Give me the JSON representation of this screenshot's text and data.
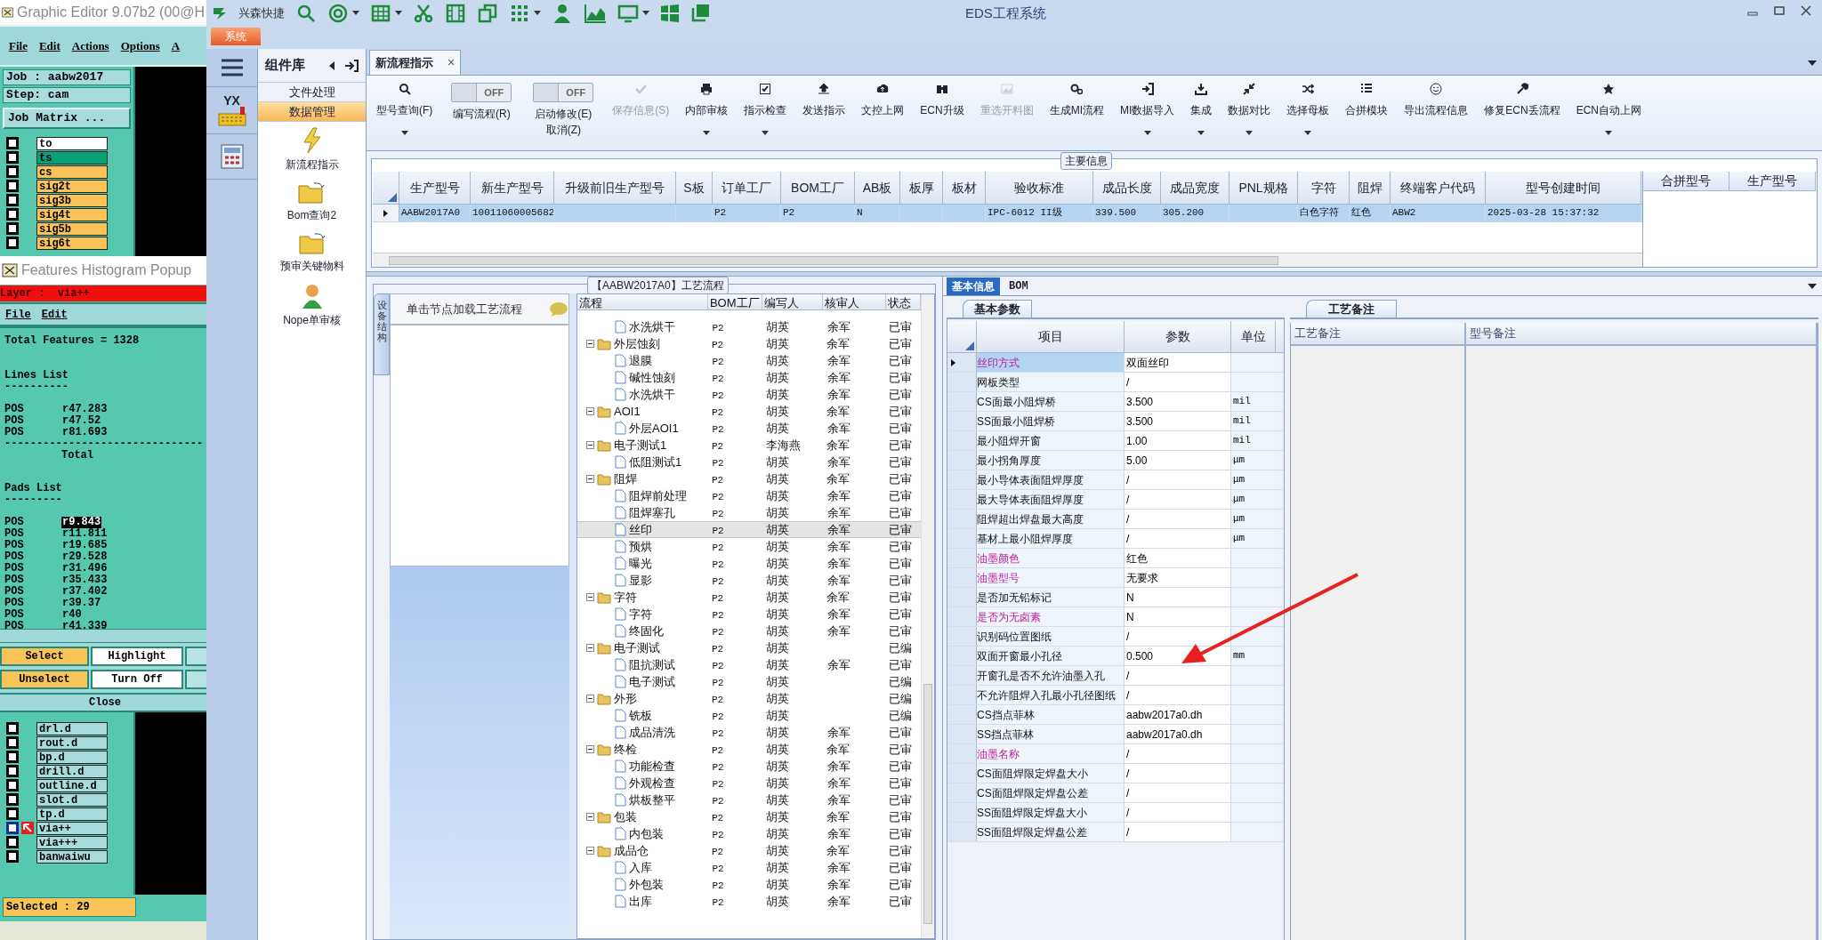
{
  "graphic_editor": {
    "title": "Graphic Editor 9.07b2 (00@H",
    "menu": [
      "File",
      "Edit",
      "Actions",
      "Options",
      "A"
    ],
    "job": "Job : aabw2017",
    "step": "Step: cam",
    "job_matrix_button": "Job Matrix ...",
    "layers_top": [
      {
        "name": "to",
        "color": "#ffffff",
        "checked": false
      },
      {
        "name": "ts",
        "color": "#0aa078",
        "checked": false
      },
      {
        "name": "cs",
        "color": "#f8c458",
        "checked": false
      },
      {
        "name": "sig2t",
        "color": "#f8c458",
        "checked": false
      },
      {
        "name": "sig3b",
        "color": "#f8c458",
        "checked": false
      },
      {
        "name": "sig4t",
        "color": "#f8c458",
        "checked": false
      },
      {
        "name": "sig5b",
        "color": "#f8c458",
        "checked": false
      },
      {
        "name": "sig6t",
        "color": "#f8c458",
        "checked": false
      }
    ],
    "layers_bottom": [
      {
        "name": "drl.d",
        "checked": false,
        "selected": false
      },
      {
        "name": "rout.d",
        "checked": false,
        "selected": false
      },
      {
        "name": "bp.d",
        "checked": false,
        "selected": false
      },
      {
        "name": "drill.d",
        "checked": false,
        "selected": false
      },
      {
        "name": "outline.d",
        "checked": false,
        "selected": false
      },
      {
        "name": "slot.d",
        "checked": false,
        "selected": false
      },
      {
        "name": "tp.d",
        "checked": false,
        "selected": false
      },
      {
        "name": "via++",
        "checked": false,
        "selected": true
      },
      {
        "name": "via+++",
        "checked": false,
        "selected": false
      },
      {
        "name": "banwaiwu",
        "checked": false,
        "selected": false
      }
    ],
    "selected_count": "Selected : 29"
  },
  "histogram_popup": {
    "title": "Features Histogram Popup",
    "layer": "Layer :  via++",
    "menu": [
      "File",
      "Edit"
    ],
    "total": "Total Features = 1328",
    "lines_heading": "Lines List",
    "lines_rule": "----------",
    "lines": [
      {
        "type": "POS",
        "size": "r47.283"
      },
      {
        "type": "POS",
        "size": "r47.52"
      },
      {
        "type": "POS",
        "size": "r81.693"
      }
    ],
    "total_rule": "-------------------------------",
    "lines_total": "Total",
    "pads_heading": "Pads List",
    "pads_rule": "---------",
    "pads": [
      {
        "type": "POS",
        "size": "r9.843",
        "selected": true
      },
      {
        "type": "POS",
        "size": "r11.811",
        "selected": false
      },
      {
        "type": "POS",
        "size": "r19.685",
        "selected": false
      },
      {
        "type": "POS",
        "size": "r29.528",
        "selected": false
      },
      {
        "type": "POS",
        "size": "r31.496",
        "selected": false
      },
      {
        "type": "POS",
        "size": "r35.433",
        "selected": false
      },
      {
        "type": "POS",
        "size": "r37.402",
        "selected": false
      },
      {
        "type": "POS",
        "size": "r39.37",
        "selected": false
      },
      {
        "type": "POS",
        "size": "r40",
        "selected": false
      },
      {
        "type": "POS",
        "size": "r41.339",
        "selected": false
      }
    ],
    "buttons": [
      {
        "label": "Select",
        "kind": "action"
      },
      {
        "label": "Highlight",
        "kind": "plain"
      },
      {
        "label": "Unselect",
        "kind": "action"
      },
      {
        "label": "Turn Off",
        "kind": "plain"
      }
    ],
    "close": "Close"
  },
  "eds": {
    "quick_access_label": "兴森快捷",
    "title": "EDS工程系统",
    "system_tab": "系统",
    "rail_logo": "YX",
    "component_library": {
      "title": "组件库",
      "categories": [
        {
          "label": "文件处理",
          "selected": false
        },
        {
          "label": "数据管理",
          "selected": true
        }
      ],
      "items": [
        {
          "label": "新流程指示",
          "kind": "bolt"
        },
        {
          "label": "Bom查询2",
          "kind": "folder"
        },
        {
          "label": "预审关键物料",
          "kind": "folder"
        },
        {
          "label": "Nope单审核",
          "kind": "person"
        }
      ]
    },
    "document_tab": {
      "label": "新流程指示",
      "close": "×"
    },
    "ribbon": [
      {
        "kind": "button",
        "label": "型号查询(F)",
        "dropdown": true,
        "disabled": false
      },
      {
        "kind": "toggle",
        "label": "编写流程(R)",
        "state": "OFF",
        "on": false
      },
      {
        "kind": "toggle",
        "label": "启动修改(E) 取消(Z)",
        "state": "OFF",
        "on": false
      },
      {
        "kind": "button",
        "label": "保存信息(S)",
        "dropdown": false,
        "disabled": true
      },
      {
        "kind": "button",
        "label": "内部审核",
        "dropdown": true,
        "disabled": false
      },
      {
        "kind": "button",
        "label": "指示检查",
        "dropdown": true,
        "disabled": false
      },
      {
        "kind": "button",
        "label": "发送指示",
        "dropdown": false,
        "disabled": false
      },
      {
        "kind": "button",
        "label": "文控上网",
        "dropdown": false,
        "disabled": false
      },
      {
        "kind": "button",
        "label": "ECN升级",
        "dropdown": false,
        "disabled": false
      },
      {
        "kind": "button",
        "label": "重选开料图",
        "dropdown": false,
        "disabled": true
      },
      {
        "kind": "button",
        "label": "生成MI流程",
        "dropdown": false,
        "disabled": false
      },
      {
        "kind": "button",
        "label": "MI数据导入",
        "dropdown": true,
        "disabled": false
      },
      {
        "kind": "button",
        "label": "集成",
        "dropdown": true,
        "disabled": false
      },
      {
        "kind": "button",
        "label": "数据对比",
        "dropdown": true,
        "disabled": false
      },
      {
        "kind": "button",
        "label": "选择母板",
        "dropdown": true,
        "disabled": false
      },
      {
        "kind": "button",
        "label": "合拼模块",
        "dropdown": false,
        "disabled": false
      },
      {
        "kind": "button",
        "label": "导出流程信息",
        "dropdown": false,
        "disabled": false
      },
      {
        "kind": "button",
        "label": "修复ECN丢流程",
        "dropdown": false,
        "disabled": false
      },
      {
        "kind": "button",
        "label": "ECN自动上网",
        "dropdown": true,
        "disabled": false
      }
    ],
    "main_info": {
      "title": "主要信息",
      "columns": [
        "生产型号",
        "新生产型号",
        "升级前旧生产型号",
        "S板",
        "订单工厂",
        "BOM工厂",
        "AB板",
        "板厚",
        "板材",
        "验收标准",
        "成品长度",
        "成品宽度",
        "PNL规格",
        "字符",
        "阻焊",
        "终端客户代码",
        "型号创建时间"
      ],
      "rows": [
        {
          "selected": true,
          "cells": [
            "AABW2017A0",
            "10011060005682",
            null,
            null,
            "P2",
            "P2",
            "N",
            null,
            null,
            "IPC-6012 II级",
            "339.500",
            "305.200",
            null,
            "白色字符",
            "红色",
            "ABW2",
            "2025-03-28 15:37:32"
          ]
        }
      ],
      "merge_columns": [
        "合拼型号",
        "生产型号"
      ]
    },
    "process_flow": {
      "title": "【AABW2017A0】工艺流程",
      "side_tab": "设备结构",
      "hint": "单击节点加载工艺流程",
      "columns": [
        "流程",
        "BOM工厂",
        "编写人",
        "核审人",
        "状态"
      ],
      "tree": [
        {
          "kind": "file",
          "label": "水洗烘干",
          "bom": "P2",
          "writer": "胡英",
          "reviewer": "余军",
          "status": "已审",
          "selected": false
        },
        {
          "kind": "folder",
          "label": "外层蚀刻",
          "bom": "P2",
          "writer": "胡英",
          "reviewer": "余军",
          "status": "已审",
          "selected": false,
          "children": [
            {
              "kind": "file",
              "label": "退膜",
              "bom": "P2",
              "writer": "胡英",
              "reviewer": "余军",
              "status": "已审",
              "selected": false
            },
            {
              "kind": "file",
              "label": "碱性蚀刻",
              "bom": "P2",
              "writer": "胡英",
              "reviewer": "余军",
              "status": "已审",
              "selected": false
            },
            {
              "kind": "file",
              "label": "水洗烘干",
              "bom": "P2",
              "writer": "胡英",
              "reviewer": "余军",
              "status": "已审",
              "selected": false
            }
          ]
        },
        {
          "kind": "folder",
          "label": "AOI1",
          "bom": "P2",
          "writer": "胡英",
          "reviewer": "余军",
          "status": "已审",
          "selected": false,
          "children": [
            {
              "kind": "file",
              "label": "外层AOI1",
              "bom": "P2",
              "writer": "胡英",
              "reviewer": "余军",
              "status": "已审",
              "selected": false
            }
          ]
        },
        {
          "kind": "folder",
          "label": "电子测试1",
          "bom": "P2",
          "writer": "李海燕",
          "reviewer": "余军",
          "status": "已审",
          "selected": false,
          "children": [
            {
              "kind": "file",
              "label": "低阻测试1",
              "bom": "P2",
              "writer": "胡英",
              "reviewer": "余军",
              "status": "已审",
              "selected": false
            }
          ]
        },
        {
          "kind": "folder",
          "label": "阻焊",
          "bom": "P2",
          "writer": "胡英",
          "reviewer": "余军",
          "status": "已审",
          "selected": false,
          "children": [
            {
              "kind": "file",
              "label": "阻焊前处理",
              "bom": "P2",
              "writer": "胡英",
              "reviewer": "余军",
              "status": "已审",
              "selected": false
            },
            {
              "kind": "file",
              "label": "阻焊塞孔",
              "bom": "P2",
              "writer": "胡英",
              "reviewer": "余军",
              "status": "已审",
              "selected": false
            },
            {
              "kind": "file",
              "label": "丝印",
              "bom": "P2",
              "writer": "胡英",
              "reviewer": "余军",
              "status": "已审",
              "selected": true
            },
            {
              "kind": "file",
              "label": "预烘",
              "bom": "P2",
              "writer": "胡英",
              "reviewer": "余军",
              "status": "已审",
              "selected": false
            },
            {
              "kind": "file",
              "label": "曝光",
              "bom": "P2",
              "writer": "胡英",
              "reviewer": "余军",
              "status": "已审",
              "selected": false
            },
            {
              "kind": "file",
              "label": "显影",
              "bom": "P2",
              "writer": "胡英",
              "reviewer": "余军",
              "status": "已审",
              "selected": false
            }
          ]
        },
        {
          "kind": "folder",
          "label": "字符",
          "bom": "P2",
          "writer": "胡英",
          "reviewer": "余军",
          "status": "已审",
          "selected": false,
          "children": [
            {
              "kind": "file",
              "label": "字符",
              "bom": "P2",
              "writer": "胡英",
              "reviewer": "余军",
              "status": "已审",
              "selected": false
            },
            {
              "kind": "file",
              "label": "终固化",
              "bom": "P2",
              "writer": "胡英",
              "reviewer": "余军",
              "status": "已审",
              "selected": false
            }
          ]
        },
        {
          "kind": "folder",
          "label": "电子测试",
          "bom": "P2",
          "writer": "胡英",
          "status": "已编",
          "selected": false,
          "children": [
            {
              "kind": "file",
              "label": "阻抗测试",
              "bom": "P2",
              "writer": "胡英",
              "reviewer": "余军",
              "status": "已审",
              "selected": false
            },
            {
              "kind": "file",
              "label": "电子测试",
              "bom": "P2",
              "writer": "胡英",
              "status": "已编",
              "selected": false
            }
          ]
        },
        {
          "kind": "folder",
          "label": "外形",
          "bom": "P2",
          "writer": "胡英",
          "status": "已编",
          "selected": false,
          "children": [
            {
              "kind": "file",
              "label": "铣板",
              "bom": "P2",
              "writer": "胡英",
              "status": "已编",
              "selected": false
            },
            {
              "kind": "file",
              "label": "成品清洗",
              "bom": "P2",
              "writer": "胡英",
              "reviewer": "余军",
              "status": "已审",
              "selected": false
            }
          ]
        },
        {
          "kind": "folder",
          "label": "终检",
          "bom": "P2",
          "writer": "胡英",
          "reviewer": "余军",
          "status": "已审",
          "selected": false,
          "children": [
            {
              "kind": "file",
              "label": "功能检查",
              "bom": "P2",
              "writer": "胡英",
              "reviewer": "余军",
              "status": "已审",
              "selected": false
            },
            {
              "kind": "file",
              "label": "外观检查",
              "bom": "P2",
              "writer": "胡英",
              "reviewer": "余军",
              "status": "已审",
              "selected": false
            },
            {
              "kind": "file",
              "label": "烘板整平",
              "bom": "P2",
              "writer": "胡英",
              "reviewer": "余军",
              "status": "已审",
              "selected": false
            }
          ]
        },
        {
          "kind": "folder",
          "label": "包装",
          "bom": "P2",
          "writer": "胡英",
          "reviewer": "余军",
          "status": "已审",
          "selected": false,
          "children": [
            {
              "kind": "file",
              "label": "内包装",
              "bom": "P2",
              "writer": "胡英",
              "reviewer": "余军",
              "status": "已审",
              "selected": false
            }
          ]
        },
        {
          "kind": "folder",
          "label": "成品仓",
          "bom": "P2",
          "writer": "胡英",
          "reviewer": "余军",
          "status": "已审",
          "selected": false,
          "children": [
            {
              "kind": "file",
              "label": "入库",
              "bom": "P2",
              "writer": "胡英",
              "reviewer": "余军",
              "status": "已审",
              "selected": false
            },
            {
              "kind": "file",
              "label": "外包装",
              "bom": "P2",
              "writer": "胡英",
              "reviewer": "余军",
              "status": "已审",
              "selected": false
            },
            {
              "kind": "file",
              "label": "出库",
              "bom": "P2",
              "writer": "胡英",
              "reviewer": "余军",
              "status": "已审",
              "selected": false
            }
          ]
        }
      ]
    },
    "detail": {
      "tabs": [
        {
          "label": "基本信息",
          "selected": true
        },
        {
          "label": "BOM",
          "selected": false
        }
      ],
      "params_tab": "基本参数",
      "params_columns": [
        "项目",
        "参数",
        "单位"
      ],
      "params": [
        {
          "item": "丝印方式",
          "value": "双面丝印",
          "flagged": true,
          "selected": true
        },
        {
          "item": "网板类型",
          "value": "/",
          "flagged": false,
          "selected": false
        },
        {
          "item": "CS面最小阻焊桥",
          "value": "3.500",
          "unit": "mil",
          "flagged": false,
          "selected": false
        },
        {
          "item": "SS面最小阻焊桥",
          "value": "3.500",
          "unit": "mil",
          "flagged": false,
          "selected": false
        },
        {
          "item": "最小阻焊开窗",
          "value": "1.00",
          "unit": "mil",
          "flagged": false,
          "selected": false
        },
        {
          "item": "最小拐角厚度",
          "value": "5.00",
          "unit": "μm",
          "flagged": false,
          "selected": false
        },
        {
          "item": "最小导体表面阻焊厚度",
          "value": "/",
          "unit": "μm",
          "flagged": false,
          "selected": false
        },
        {
          "item": "最大导体表面阻焊厚度",
          "value": "/",
          "unit": "μm",
          "flagged": false,
          "selected": false
        },
        {
          "item": "阻焊超出焊盘最大高度",
          "value": "/",
          "unit": "μm",
          "flagged": false,
          "selected": false
        },
        {
          "item": "基材上最小阻焊厚度",
          "value": "/",
          "unit": "μm",
          "flagged": false,
          "selected": false
        },
        {
          "item": "油墨颜色",
          "value": "红色",
          "flagged": true,
          "selected": false
        },
        {
          "item": "油墨型号",
          "value": "无要求",
          "flagged": true,
          "selected": false
        },
        {
          "item": "是否加无铅标记",
          "value": "N",
          "flagged": false,
          "selected": false
        },
        {
          "item": "是否为无卤素",
          "value": "N",
          "flagged": true,
          "selected": false
        },
        {
          "item": "识别码位置图纸",
          "value": "/",
          "flagged": false,
          "selected": false
        },
        {
          "item": "双面开窗最小孔径",
          "value": "0.500",
          "unit": "mm",
          "flagged": false,
          "selected": false
        },
        {
          "item": "开窗孔是否不允许油墨入孔",
          "value": "/",
          "flagged": false,
          "selected": false
        },
        {
          "item": "不允许阻焊入孔最小孔径图纸",
          "value": "/",
          "flagged": false,
          "selected": false
        },
        {
          "item": "CS挡点菲林",
          "value": "aabw2017a0.dh",
          "flagged": false,
          "selected": false
        },
        {
          "item": "SS挡点菲林",
          "value": "aabw2017a0.dh",
          "flagged": false,
          "selected": false
        },
        {
          "item": "油墨名称",
          "value": "/",
          "flagged": true,
          "selected": false
        },
        {
          "item": "CS面阻焊限定焊盘大小",
          "value": "/",
          "flagged": false,
          "selected": false
        },
        {
          "item": "CS面阻焊限定焊盘公差",
          "value": "/",
          "flagged": false,
          "selected": false
        },
        {
          "item": "SS面阻焊限定焊盘大小",
          "value": "/",
          "flagged": false,
          "selected": false
        },
        {
          "item": "SS面阻焊限定焊盘公差",
          "value": "/",
          "flagged": false,
          "selected": false
        }
      ],
      "notes_tab": "工艺备注",
      "notes_columns": [
        "工艺备注",
        "型号备注"
      ]
    }
  }
}
